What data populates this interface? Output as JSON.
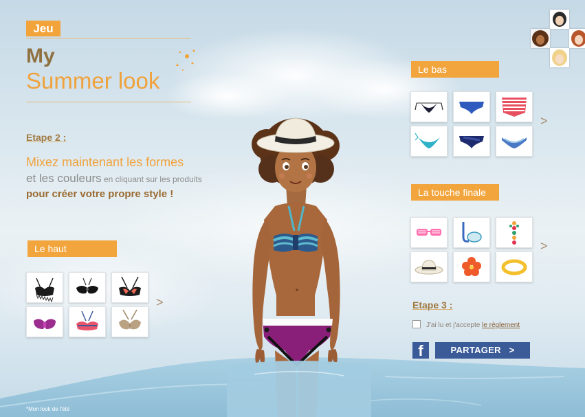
{
  "header": {
    "tag": "Jeu",
    "title_line1": "My",
    "title_line2": "Summer look"
  },
  "step2": {
    "title": "Etape 2 :",
    "line1": "Mixez maintenant les formes",
    "line2a": "et les couleurs",
    "line2b": " en cliquant sur les produits",
    "line3": "pour créer votre propre style !"
  },
  "sections": {
    "haut": {
      "label": "Le haut",
      "items": [
        "black-frilled-halter-top",
        "black-bandeau-top",
        "black-coral-halter-top",
        "purple-twist-bandeau-top",
        "blue-coral-halter-top",
        "taupe-halter-top"
      ],
      "next": ">"
    },
    "bas": {
      "label": "Le bas",
      "items": [
        "dark-string-bottom",
        "blue-brief-bottom",
        "red-striped-high-waist-bottom",
        "turquoise-tie-bottom",
        "navy-wrap-bottom",
        "blue-striped-bottom"
      ],
      "next": ">"
    },
    "touche": {
      "label": "La touche finale",
      "items": [
        "pink-shutter-sunglasses",
        "snorkel-mask",
        "beaded-necklace",
        "panama-hat",
        "hibiscus-flower",
        "yellow-bangle"
      ],
      "next": ">"
    }
  },
  "step3": {
    "title": "Etape 3 :",
    "accept_text": "J'ai lu et j'accepte",
    "rules_link": "le règlement",
    "fb_label": "f",
    "share_label": "PARTAGER",
    "share_arrow": ">"
  },
  "footer": {
    "note": "*Mon look de l'été"
  },
  "avatars": [
    "black-bob-avatar",
    "afro-avatar",
    "red-hair-avatar",
    "blonde-avatar"
  ],
  "colors": {
    "accent_orange": "#f2a33a",
    "title_brown": "#8f7040",
    "facebook_blue": "#3a5a98",
    "water": "#9ac6dc"
  }
}
